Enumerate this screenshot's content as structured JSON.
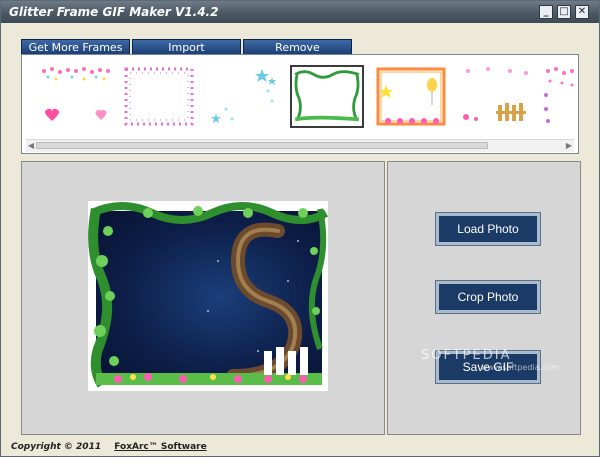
{
  "window": {
    "title": "Glitter Frame GIF Maker V1.4.2",
    "controls": {
      "minimize": "_",
      "maximize": "□",
      "close": "✕"
    }
  },
  "tabs": [
    {
      "label": "Get More Frames"
    },
    {
      "label": "Import"
    },
    {
      "label": "Remove"
    }
  ],
  "frames": {
    "thumbnails": [
      {
        "icon": "frame-hearts-icon"
      },
      {
        "icon": "frame-pink-dots-icon"
      },
      {
        "icon": "frame-stars-icon"
      },
      {
        "icon": "frame-vines-icon",
        "selected": true
      },
      {
        "icon": "frame-balloons-icon"
      },
      {
        "icon": "frame-fence-icon"
      },
      {
        "icon": "frame-pink-sparkle-icon"
      }
    ]
  },
  "actions": {
    "load_label": "Load Photo",
    "crop_label": "Crop Photo",
    "save_label": "Save GIF"
  },
  "watermark": {
    "text": "SOFTPEDIA",
    "sub": "www.softpedia.com"
  },
  "footer": {
    "copyright": "Copyright © 2011",
    "company": "FoxArc™ Software"
  },
  "colors": {
    "accent": "#1c3a66",
    "tab": "#2b5590"
  }
}
